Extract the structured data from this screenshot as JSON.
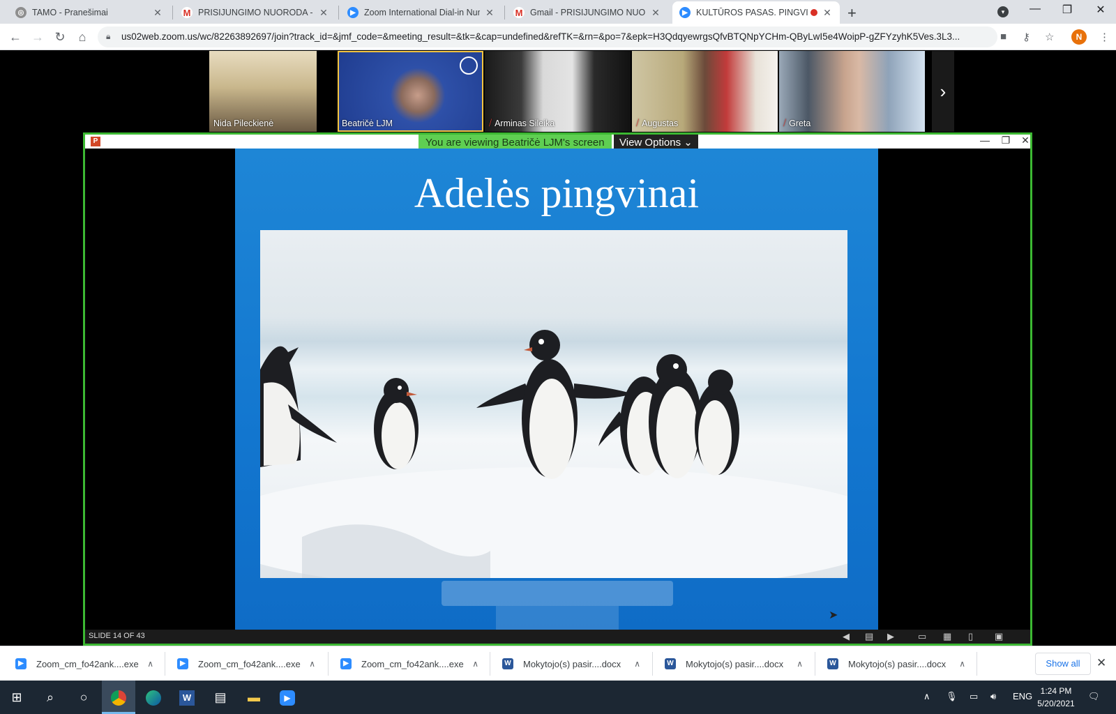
{
  "browser": {
    "tabs": [
      {
        "title": "TAMO - Pranešimai",
        "icon": "tamo-icon",
        "color": "#8e8e8e"
      },
      {
        "title": "PRISIJUNGIMO NUORODA - npil",
        "icon": "gmail-icon",
        "color": "#d93025"
      },
      {
        "title": "Zoom International Dial-in Numb",
        "icon": "zoom-icon",
        "color": "#2d8cff"
      },
      {
        "title": "Gmail - PRISIJUNGIMO NUOROD",
        "icon": "gmail-icon",
        "color": "#d93025"
      },
      {
        "title": "KULTŪROS PASAS. PINGVINA",
        "icon": "zoom-icon",
        "color": "#2d8cff",
        "active": true,
        "recording": true
      }
    ],
    "url": "us02web.zoom.us/wc/82263892697/join?track_id=&jmf_code=&meeting_result=&tk=&cap=undefined&refTK=&rn=&po=7&epk=H3QdqyewrgsQfvBTQNpYCHm-QByLwI5e4WoipP-gZFYzyhK5Ves.3L3...",
    "profile_initial": "N",
    "profile_color": "#e8710a"
  },
  "zoom": {
    "participants": [
      {
        "name": "Nida Pileckienė",
        "muted": false
      },
      {
        "name": "Beatričė LJM",
        "muted": false,
        "speaking": true
      },
      {
        "name": "Arminas Sileika",
        "muted": true
      },
      {
        "name": "Augustas",
        "muted": true
      },
      {
        "name": "Greta",
        "muted": true
      }
    ],
    "viewing_banner": "You are viewing Beatričė LJM's screen",
    "view_options": "View Options",
    "slide_title": "Adelės pingvinai",
    "slide_counter": "SLIDE 14 OF 43"
  },
  "downloads": [
    {
      "name": "Zoom_cm_fo42ank....exe",
      "type": "zoom",
      "color": "#2d8cff"
    },
    {
      "name": "Zoom_cm_fo42ank....exe",
      "type": "zoom",
      "color": "#2d8cff"
    },
    {
      "name": "Zoom_cm_fo42ank....exe",
      "type": "zoom",
      "color": "#2d8cff"
    },
    {
      "name": "Mokytojo(s) pasir....docx",
      "type": "word",
      "color": "#2b579a"
    },
    {
      "name": "Mokytojo(s) pasir....docx",
      "type": "word",
      "color": "#2b579a"
    },
    {
      "name": "Mokytojo(s) pasir....docx",
      "type": "word",
      "color": "#2b579a"
    }
  ],
  "show_all": "Show all",
  "taskbar": {
    "language": "ENG",
    "time": "1:24 PM",
    "date": "5/20/2021"
  }
}
